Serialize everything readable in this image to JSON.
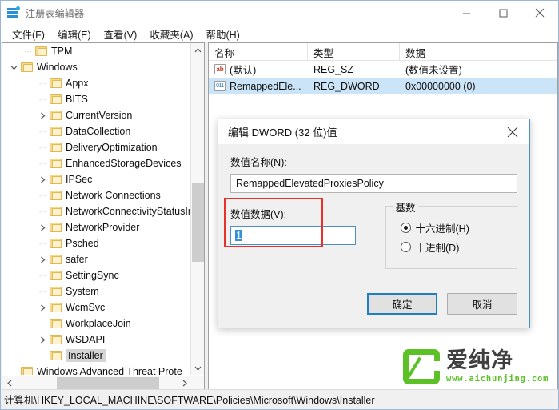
{
  "window": {
    "title": "注册表编辑器",
    "icon": "registry-editor-icon",
    "controls": {
      "minimize": "minimize-icon",
      "maximize": "maximize-icon",
      "close": "close-icon"
    }
  },
  "menubar": {
    "items": [
      {
        "label": "文件(F)"
      },
      {
        "label": "编辑(E)"
      },
      {
        "label": "查看(V)"
      },
      {
        "label": "收藏夹(A)"
      },
      {
        "label": "帮助(H)"
      }
    ]
  },
  "tree": {
    "nodes": [
      {
        "label": "TPM",
        "indent": 1,
        "expander": "none",
        "selected": false
      },
      {
        "label": "Windows",
        "indent": 0,
        "expander": "expanded",
        "selected": false
      },
      {
        "label": "Appx",
        "indent": 2,
        "expander": "none",
        "selected": false
      },
      {
        "label": "BITS",
        "indent": 2,
        "expander": "none",
        "selected": false
      },
      {
        "label": "CurrentVersion",
        "indent": 2,
        "expander": "collapsed",
        "selected": false
      },
      {
        "label": "DataCollection",
        "indent": 2,
        "expander": "none",
        "selected": false
      },
      {
        "label": "DeliveryOptimization",
        "indent": 2,
        "expander": "none",
        "selected": false
      },
      {
        "label": "EnhancedStorageDevices",
        "indent": 2,
        "expander": "none",
        "selected": false
      },
      {
        "label": "IPSec",
        "indent": 2,
        "expander": "collapsed",
        "selected": false
      },
      {
        "label": "Network Connections",
        "indent": 2,
        "expander": "none",
        "selected": false
      },
      {
        "label": "NetworkConnectivityStatusInc",
        "indent": 2,
        "expander": "none",
        "selected": false
      },
      {
        "label": "NetworkProvider",
        "indent": 2,
        "expander": "collapsed",
        "selected": false
      },
      {
        "label": "Psched",
        "indent": 2,
        "expander": "none",
        "selected": false
      },
      {
        "label": "safer",
        "indent": 2,
        "expander": "collapsed",
        "selected": false
      },
      {
        "label": "SettingSync",
        "indent": 2,
        "expander": "none",
        "selected": false
      },
      {
        "label": "System",
        "indent": 2,
        "expander": "none",
        "selected": false
      },
      {
        "label": "WcmSvc",
        "indent": 2,
        "expander": "collapsed",
        "selected": false
      },
      {
        "label": "WorkplaceJoin",
        "indent": 2,
        "expander": "none",
        "selected": false
      },
      {
        "label": "WSDAPI",
        "indent": 2,
        "expander": "collapsed",
        "selected": false
      },
      {
        "label": "Installer",
        "indent": 2,
        "expander": "none",
        "selected": true
      },
      {
        "label": "Windows Advanced Threat Prote",
        "indent": 0,
        "expander": "none",
        "selected": false
      }
    ],
    "scroll": {
      "up_arrow": "chevron-up-icon",
      "down_arrow": "chevron-down-icon",
      "left_arrow": "chevron-left-icon",
      "right_arrow": "chevron-right-icon"
    }
  },
  "list": {
    "columns": [
      {
        "label": "名称"
      },
      {
        "label": "类型"
      },
      {
        "label": "数据"
      }
    ],
    "rows": [
      {
        "icon": "string-value-icon",
        "name": "(默认)",
        "type": "REG_SZ",
        "data": "(数值未设置)",
        "selected": false
      },
      {
        "icon": "dword-value-icon",
        "name": "RemappedEle...",
        "type": "REG_DWORD",
        "data": "0x00000000 (0)",
        "selected": true
      }
    ]
  },
  "statusbar": {
    "path": "计算机\\HKEY_LOCAL_MACHINE\\SOFTWARE\\Policies\\Microsoft\\Windows\\Installer"
  },
  "dialog": {
    "title": "编辑 DWORD (32 位)值",
    "close_icon": "close-icon",
    "value_name": {
      "label": "数值名称(N):",
      "value": "RemappedElevatedProxiesPolicy"
    },
    "value_data": {
      "label": "数值数据(V):",
      "value": "1",
      "highlighted": true
    },
    "base": {
      "legend": "基数",
      "options": [
        {
          "label": "十六进制(H)",
          "selected": true
        },
        {
          "label": "十进制(D)",
          "selected": false
        }
      ]
    },
    "buttons": [
      {
        "label": "确定",
        "default": true
      },
      {
        "label": "取消",
        "default": false
      }
    ]
  },
  "watermark": {
    "brand": "爱纯净",
    "url": "www.aichunjing.com",
    "color": "#5cc127"
  }
}
